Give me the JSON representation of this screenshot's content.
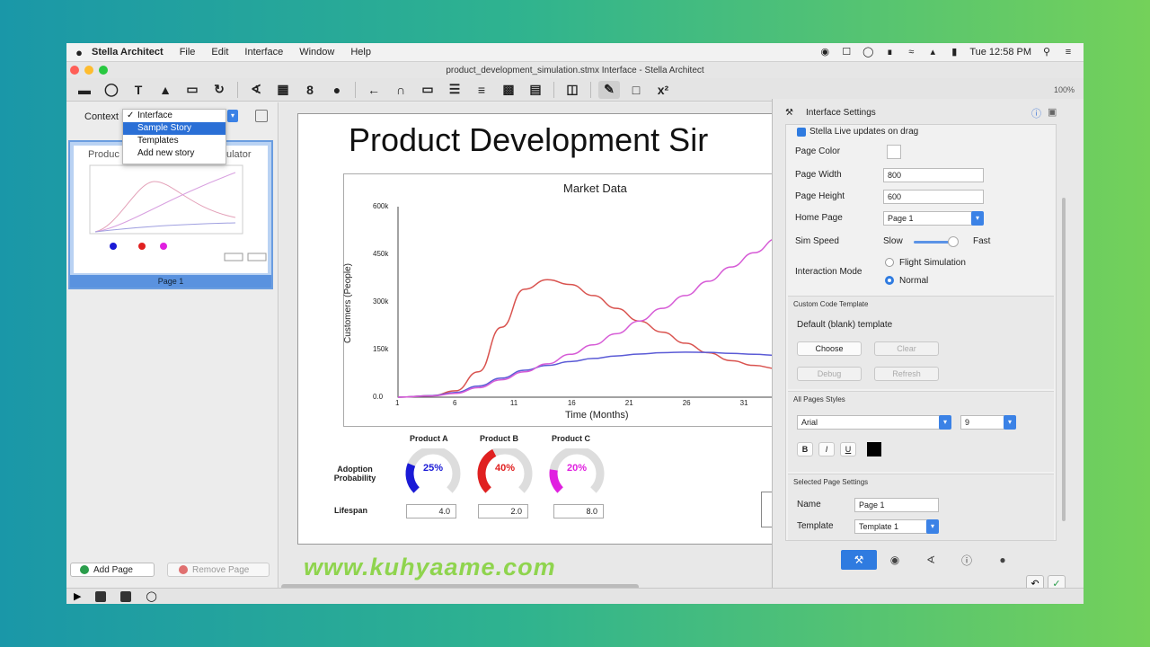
{
  "menubar": {
    "apple": "",
    "app_name": "Stella Architect",
    "menus": [
      "File",
      "Edit",
      "Interface",
      "Window",
      "Help"
    ],
    "clock": "Tue 12:58 PM"
  },
  "window": {
    "title": "product_development_simulation.stmx Interface - Stella Architect"
  },
  "toolbar": {
    "zoom": "100%"
  },
  "left_panel": {
    "context_label": "Context",
    "context_menu": [
      {
        "label": "Interface",
        "checked": true
      },
      {
        "label": "Sample Story",
        "selected": true
      },
      {
        "label": "Templates"
      },
      {
        "label": "Add new story"
      }
    ],
    "thumb_title_left": "Produc",
    "thumb_title_right": "ulator",
    "page_label": "Page 1",
    "add_page": "Add Page",
    "remove_page": "Remove Page"
  },
  "page": {
    "title": "Product Development Sir"
  },
  "chart_data": {
    "type": "line",
    "title": "Market Data",
    "xlabel": "Time (Months)",
    "ylabel": "Customers (People)",
    "x_ticks": [
      "1",
      "6",
      "11",
      "16",
      "21",
      "26",
      "31"
    ],
    "y_ticks": [
      "0.0",
      "150k",
      "300k",
      "450k",
      "600k"
    ],
    "ylim": [
      0,
      600000
    ],
    "xlim": [
      1,
      34
    ],
    "x": [
      1,
      4,
      6,
      8,
      10,
      12,
      14,
      16,
      18,
      20,
      22,
      24,
      26,
      28,
      30,
      32,
      34
    ],
    "series": [
      {
        "color": "#d9534f",
        "values": [
          0,
          5000,
          20000,
          80000,
          220000,
          340000,
          370000,
          355000,
          320000,
          280000,
          240000,
          205000,
          170000,
          140000,
          115000,
          100000,
          90000
        ]
      },
      {
        "color": "#5b5bd6",
        "values": [
          0,
          5000,
          15000,
          35000,
          60000,
          85000,
          100000,
          112000,
          122000,
          130000,
          136000,
          140000,
          142000,
          141000,
          138000,
          135000,
          132000
        ]
      },
      {
        "color": "#d65bd6",
        "values": [
          0,
          4000,
          12000,
          30000,
          55000,
          80000,
          105000,
          135000,
          165000,
          200000,
          240000,
          280000,
          320000,
          365000,
          410000,
          455000,
          500000
        ]
      }
    ]
  },
  "controls": {
    "product_headers": [
      "Product A",
      "Product B",
      "Product C"
    ],
    "adoption_label": "Adoption Probability",
    "adoption_values": [
      "25%",
      "40%",
      "20%"
    ],
    "adoption_fractions": [
      0.25,
      0.4,
      0.2
    ],
    "adoption_colors": [
      "#1a1ad6",
      "#e02020",
      "#e020e0"
    ],
    "lifespan_label": "Lifespan",
    "lifespan_values": [
      "4.0",
      "2.0",
      "8.0"
    ]
  },
  "inspector": {
    "title": "Interface Settings",
    "live_updates": "Stella Live updates on drag",
    "page_color_label": "Page Color",
    "page_width_label": "Page Width",
    "page_width": "800",
    "page_height_label": "Page Height",
    "page_height": "600",
    "home_page_label": "Home Page",
    "home_page": "Page 1",
    "sim_speed_label": "Sim Speed",
    "slow": "Slow",
    "fast": "Fast",
    "interaction_mode_label": "Interaction Mode",
    "mode_flight": "Flight Simulation",
    "mode_normal": "Normal",
    "custom_code_header": "Custom Code Template",
    "template_name": "Default (blank) template",
    "choose": "Choose",
    "clear": "Clear",
    "debug": "Debug",
    "refresh": "Refresh",
    "all_pages_header": "All Pages Styles",
    "font": "Arial",
    "font_size": "9",
    "bold": "B",
    "italic": "I",
    "underline": "U",
    "selected_page_header": "Selected Page Settings",
    "name_label": "Name",
    "name_value": "Page 1",
    "template_label": "Template",
    "template_value": "Template 1"
  },
  "watermark": "www.kuhyaame.com"
}
